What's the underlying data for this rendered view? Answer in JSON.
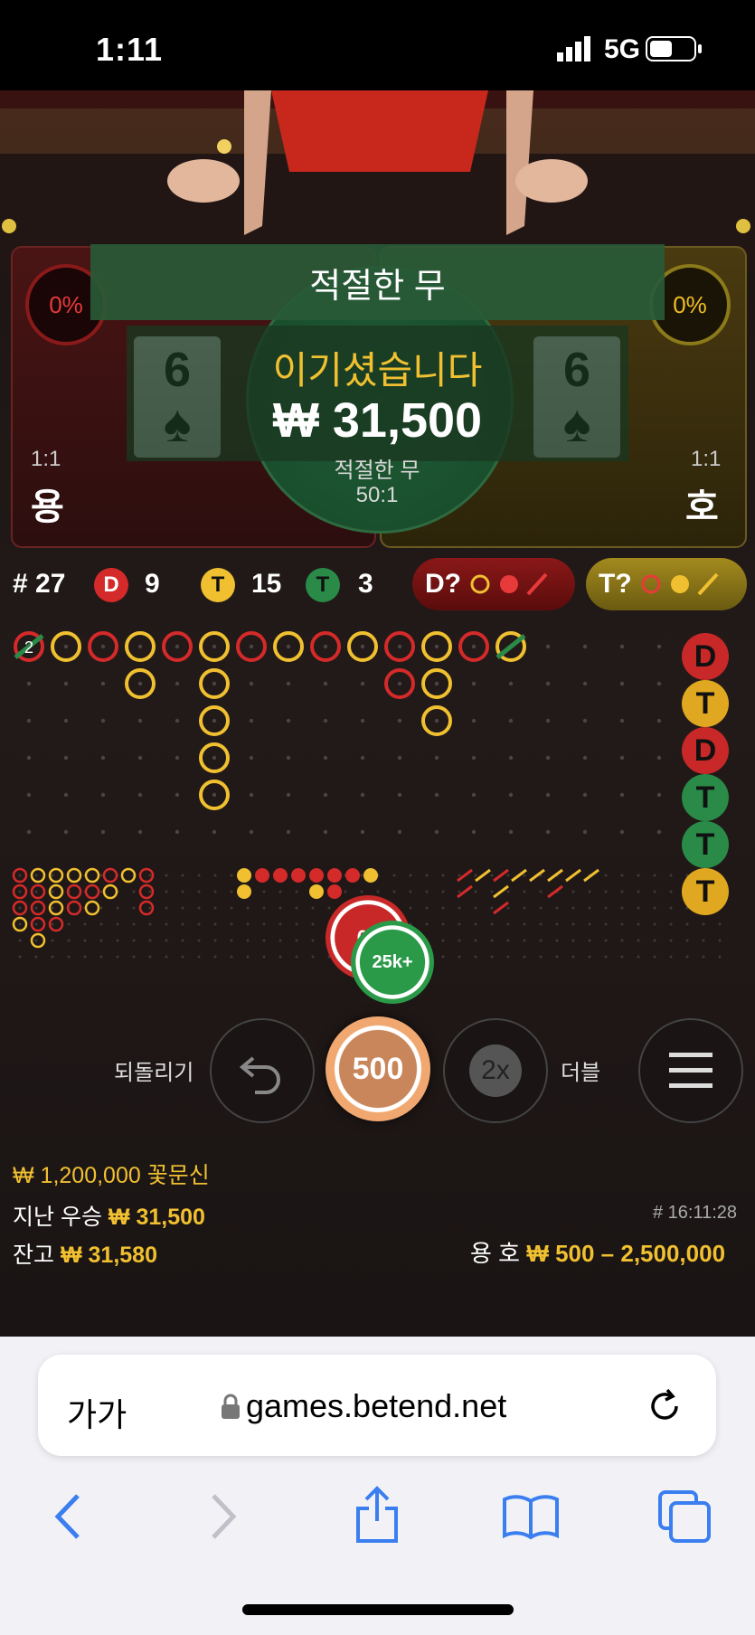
{
  "status_bar": {
    "time": "1:11",
    "network": "5G"
  },
  "game": {
    "banner": "적절한 무",
    "result_text": "이기셨습니다",
    "win_amount": "₩ 31,500",
    "tie": {
      "label": "적절한 무",
      "odds": "50:1",
      "pct": "0%"
    },
    "dragon": {
      "name": "용",
      "odds": "1:1",
      "pct": "0%",
      "card_rank": "6",
      "card_suit": "♠"
    },
    "tiger": {
      "name": "호",
      "odds": "1:1",
      "pct": "0%",
      "card_rank": "6",
      "card_suit": "♠"
    }
  },
  "stats": {
    "round_label": "# 27",
    "dragon_badge": "D",
    "dragon_count": "9",
    "tiger_badge": "T",
    "tiger_count": "15",
    "tie_badge": "T",
    "tie_count": "3",
    "dragon_predict": "D?",
    "tiger_predict": "T?"
  },
  "big_road": [
    {
      "col": 0,
      "cells": [
        {
          "row": 0,
          "c": "R",
          "tie": 2
        }
      ]
    },
    {
      "col": 1,
      "cells": [
        {
          "row": 0,
          "c": "Y"
        }
      ]
    },
    {
      "col": 2,
      "cells": [
        {
          "row": 0,
          "c": "R"
        }
      ]
    },
    {
      "col": 3,
      "cells": [
        {
          "row": 0,
          "c": "Y"
        },
        {
          "row": 1,
          "c": "Y"
        }
      ]
    },
    {
      "col": 4,
      "cells": [
        {
          "row": 0,
          "c": "R"
        }
      ]
    },
    {
      "col": 5,
      "cells": [
        {
          "row": 0,
          "c": "Y"
        },
        {
          "row": 1,
          "c": "Y"
        },
        {
          "row": 2,
          "c": "Y"
        },
        {
          "row": 3,
          "c": "Y"
        },
        {
          "row": 4,
          "c": "Y"
        }
      ]
    },
    {
      "col": 6,
      "cells": [
        {
          "row": 0,
          "c": "R"
        }
      ]
    },
    {
      "col": 7,
      "cells": [
        {
          "row": 0,
          "c": "Y"
        }
      ]
    },
    {
      "col": 8,
      "cells": [
        {
          "row": 0,
          "c": "R"
        }
      ]
    },
    {
      "col": 9,
      "cells": [
        {
          "row": 0,
          "c": "Y"
        }
      ]
    },
    {
      "col": 10,
      "cells": [
        {
          "row": 0,
          "c": "R"
        },
        {
          "row": 1,
          "c": "R"
        }
      ]
    },
    {
      "col": 11,
      "cells": [
        {
          "row": 0,
          "c": "Y"
        },
        {
          "row": 1,
          "c": "Y"
        },
        {
          "row": 2,
          "c": "Y"
        }
      ]
    },
    {
      "col": 12,
      "cells": [
        {
          "row": 0,
          "c": "R"
        }
      ]
    },
    {
      "col": 13,
      "cells": [
        {
          "row": 0,
          "c": "Y",
          "slash": true
        }
      ]
    }
  ],
  "side_predictions": [
    {
      "label": "D",
      "color": "#c82828"
    },
    {
      "label": "T",
      "color": "#e0a820"
    },
    {
      "label": "D",
      "color": "#c82828"
    },
    {
      "label": "T",
      "color": "#2a8a48"
    },
    {
      "label": "T",
      "color": "#2a8a48"
    },
    {
      "label": "T",
      "color": "#e0a820"
    }
  ],
  "chips": {
    "red_chip": "60",
    "green_chip": "25k+",
    "selected_chip": "500"
  },
  "controls": {
    "undo_label": "되돌리기",
    "double_label": "더블",
    "double_icon": "2x"
  },
  "info": {
    "jackpot": "₩ 1,200,000 꽃문신",
    "last_win_label": "지난 우승",
    "last_win_value": "₩ 31,500",
    "balance_label": "잔고",
    "balance_value": "₩ 31,580",
    "round_time": "# 16:11:28",
    "limits_label": "용 호",
    "limits_value": "₩ 500 – 2,500,000"
  },
  "browser": {
    "text_size": "가가",
    "url": "games.betend.net"
  },
  "colors": {
    "dragon": "#d42a2a",
    "tiger": "#f0c030",
    "tie": "#2a8a48"
  }
}
